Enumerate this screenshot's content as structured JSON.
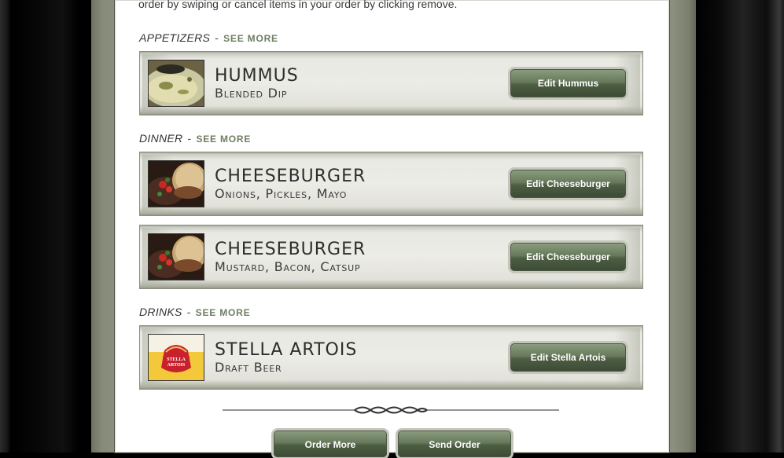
{
  "intro_text": "order by swiping or cancel items in your order by clicking remove.",
  "sections": [
    {
      "category": "APPETIZERS",
      "see_more": "SEE MORE",
      "items": [
        {
          "name": "HUMMUS",
          "description": "Blended Dip",
          "edit_label": "Edit Hummus",
          "thumb": "hummus-photo"
        }
      ]
    },
    {
      "category": "DINNER",
      "see_more": "SEE MORE",
      "items": [
        {
          "name": "CHEESEBURGER",
          "description": "Onions, Pickles, Mayo",
          "edit_label": "Edit Cheeseburger",
          "thumb": "cheeseburger-photo"
        },
        {
          "name": "CHEESEBURGER",
          "description": "Mustard, Bacon, Catsup",
          "edit_label": "Edit Cheeseburger",
          "thumb": "cheeseburger-photo"
        }
      ]
    },
    {
      "category": "DRINKS",
      "see_more": "SEE MORE",
      "items": [
        {
          "name": "STELLA ARTOIS",
          "description": "Draft Beer",
          "edit_label": "Edit Stella Artois",
          "thumb": "stella-artois-logo"
        }
      ]
    }
  ],
  "actions": {
    "order_more_label": "Order More",
    "send_order_label": "Send Order"
  },
  "colors": {
    "accent_green": "#5a6b4f",
    "see_more": "#6f7d62",
    "bezel": "#8c8f80"
  }
}
